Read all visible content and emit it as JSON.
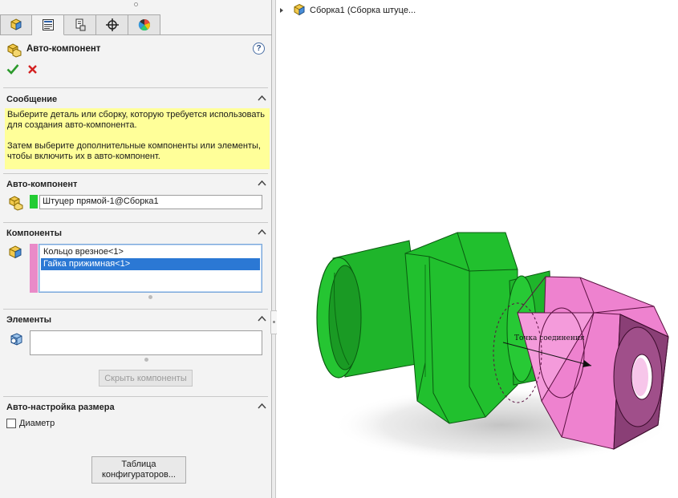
{
  "panel": {
    "title": "Авто-компонент",
    "help_label": "?",
    "tabs": [
      "feature-manager-icon",
      "property-manager-icon",
      "configuration-manager-icon",
      "dimxpert-icon",
      "display-manager-icon"
    ],
    "sections": {
      "message": {
        "title": "Сообщение",
        "lines": [
          "Выберите деталь или сборку, которую требуется использовать для создания авто-компонента.",
          "Затем выберите дополнительные компоненты или элементы, чтобы включить их в авто-компонент."
        ]
      },
      "auto_component": {
        "title": "Авто-компонент",
        "value": "Штуцер прямой-1@Сборка1",
        "swatch_color": "#22cc33"
      },
      "components": {
        "title": "Компоненты",
        "items": [
          "Кольцо врезное<1>",
          "Гайка прижимная<1>"
        ],
        "selected_index": 1,
        "swatch_color": "#e98ac8"
      },
      "elements": {
        "title": "Элементы",
        "value": "",
        "hide_button": "Скрыть компоненты"
      },
      "auto_size": {
        "title": "Авто-настройка размера",
        "checkbox_label": "Диаметр",
        "checked": false
      }
    },
    "config_table_button": [
      "Таблица",
      "конфигураторов..."
    ]
  },
  "viewport": {
    "tree_label": "Сборка1  (Сборка штуце...",
    "annotation": "Точка соединения",
    "colors": {
      "fitting": "#1fbf2b",
      "nut": "#ee82cf"
    }
  }
}
